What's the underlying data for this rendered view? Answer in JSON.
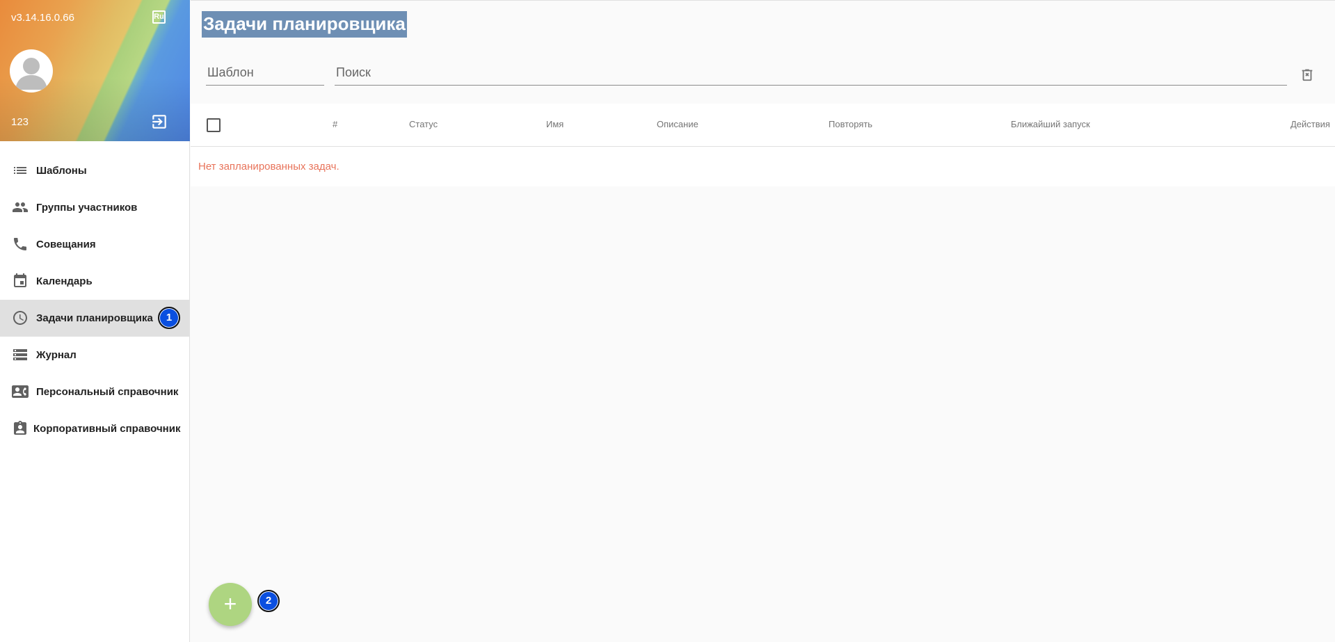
{
  "sidebar": {
    "version": "v3.14.16.0.66",
    "language_badge": "Ru",
    "username": "123",
    "items": [
      {
        "label": "Шаблоны",
        "icon": "list-icon"
      },
      {
        "label": "Группы участников",
        "icon": "people-icon"
      },
      {
        "label": "Совещания",
        "icon": "phone-icon"
      },
      {
        "label": "Календарь",
        "icon": "calendar-icon"
      },
      {
        "label": "Задачи планировщика",
        "icon": "clock-icon",
        "active": true
      },
      {
        "label": "Журнал",
        "icon": "storage-icon"
      },
      {
        "label": "Персональный справочник",
        "icon": "contacts-icon"
      },
      {
        "label": "Корпоративный справочник",
        "icon": "badge-icon"
      }
    ]
  },
  "main": {
    "title": "Задачи планировщика",
    "template_placeholder": "Шаблон",
    "search_placeholder": "Поиск",
    "table": {
      "columns": [
        "#",
        "Статус",
        "Имя",
        "Описание",
        "Повторять",
        "Ближайший запуск",
        "Действия"
      ],
      "empty_message": "Нет запланированных задач."
    },
    "fab_label": "+"
  },
  "annotations": {
    "marker_1": "1",
    "marker_2": "2"
  },
  "colors": {
    "active_item_bg": "#e0e0e0",
    "empty_text": "#e8735a",
    "fab": "#aed581",
    "marker": "#0a4fe0",
    "title_highlight": "#6e8fb4"
  }
}
